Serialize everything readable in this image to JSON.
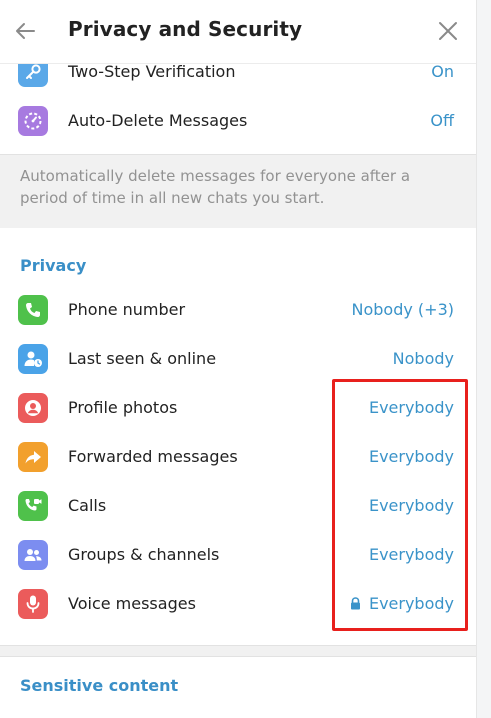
{
  "header": {
    "title": "Privacy and Security",
    "back_icon": "arrow-left-icon",
    "close_icon": "close-icon"
  },
  "security": {
    "items": [
      {
        "label": "Two-Step Verification",
        "value": "On",
        "icon": "key-icon",
        "color": "#5aa8e8"
      },
      {
        "label": "Auto-Delete Messages",
        "value": "Off",
        "icon": "timer-icon",
        "color": "#a77ae0"
      }
    ],
    "note": "Automatically delete messages for everyone after a period of time in all new chats you start."
  },
  "privacy": {
    "title": "Privacy",
    "items": [
      {
        "label": "Phone number",
        "value": "Nobody (+3)",
        "icon": "phone-icon",
        "color": "#4fc14b"
      },
      {
        "label": "Last seen & online",
        "value": "Nobody",
        "icon": "person-clock-icon",
        "color": "#4aa3e8"
      },
      {
        "label": "Profile photos",
        "value": "Everybody",
        "icon": "profile-icon",
        "color": "#eb5b5b"
      },
      {
        "label": "Forwarded messages",
        "value": "Everybody",
        "icon": "forward-icon",
        "color": "#f2a02d"
      },
      {
        "label": "Calls",
        "value": "Everybody",
        "icon": "video-call-icon",
        "color": "#4fc14b"
      },
      {
        "label": "Groups & channels",
        "value": "Everybody",
        "icon": "group-icon",
        "color": "#7c8df0"
      },
      {
        "label": "Voice messages",
        "value": "Everybody",
        "icon": "microphone-icon",
        "color": "#eb5b5b",
        "locked": true
      }
    ]
  },
  "sensitive": {
    "title": "Sensitive content"
  },
  "colors": {
    "accent": "#3a93c9",
    "highlight": "#e8201d"
  }
}
